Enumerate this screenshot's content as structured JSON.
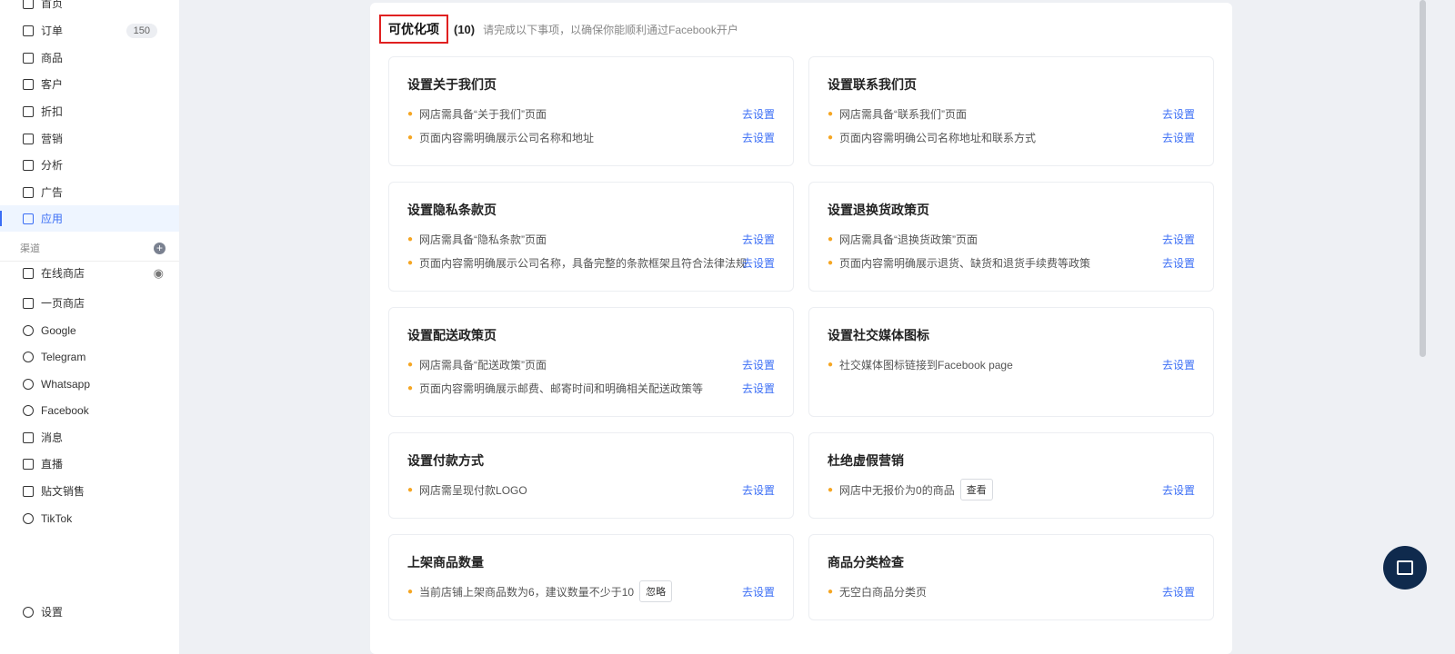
{
  "sidebar": {
    "items": [
      {
        "label": "首页",
        "icon": "home-icon"
      },
      {
        "label": "订单",
        "icon": "order-icon",
        "badge": "150"
      },
      {
        "label": "商品",
        "icon": "bag-icon"
      },
      {
        "label": "客户",
        "icon": "user-icon"
      },
      {
        "label": "折扣",
        "icon": "tag-icon"
      },
      {
        "label": "营销",
        "icon": "cube-icon"
      },
      {
        "label": "分析",
        "icon": "pie-chart-icon"
      },
      {
        "label": "广告",
        "icon": "monitor-icon"
      },
      {
        "label": "应用",
        "icon": "app-icon",
        "active": true
      }
    ],
    "section_label": "渠道",
    "channels": [
      {
        "label": "在线商店",
        "icon": "store-icon"
      },
      {
        "label": "一页商店",
        "icon": "page-icon"
      },
      {
        "label": "Google",
        "icon": "google-icon"
      },
      {
        "label": "Telegram",
        "icon": "telegram-icon"
      },
      {
        "label": "Whatsapp",
        "icon": "whatsapp-icon"
      },
      {
        "label": "Facebook",
        "icon": "facebook-icon"
      },
      {
        "label": "消息",
        "icon": "message-icon"
      },
      {
        "label": "直播",
        "icon": "video-icon"
      },
      {
        "label": "贴文销售",
        "icon": "post-icon"
      },
      {
        "label": "TikTok",
        "icon": "tiktok-icon"
      }
    ],
    "settings": "设置"
  },
  "header": {
    "title": "可优化项",
    "count": "(10)",
    "subtitle": "请完成以下事项，以确保你能顺利通过Facebook开户"
  },
  "cards": [
    {
      "title": "设置关于我们页",
      "items": [
        {
          "text": "网店需具备“关于我们”页面",
          "action": "去设置"
        },
        {
          "text": "页面内容需明确展示公司名称和地址",
          "action": "去设置"
        }
      ]
    },
    {
      "title": "设置联系我们页",
      "items": [
        {
          "text": "网店需具备“联系我们”页面",
          "action": "去设置"
        },
        {
          "text": "页面内容需明确公司名称地址和联系方式",
          "action": "去设置"
        }
      ]
    },
    {
      "title": "设置隐私条款页",
      "items": [
        {
          "text": "网店需具备“隐私条款”页面",
          "action": "去设置"
        },
        {
          "text": "页面内容需明确展示公司名称，具备完整的条款框架且符合法律法规",
          "action": "去设置"
        }
      ]
    },
    {
      "title": "设置退换货政策页",
      "items": [
        {
          "text": "网店需具备“退换货政策”页面",
          "action": "去设置"
        },
        {
          "text": "页面内容需明确展示退货、缺货和退货手续费等政策",
          "action": "去设置"
        }
      ]
    },
    {
      "title": "设置配送政策页",
      "items": [
        {
          "text": "网店需具备“配送政策”页面",
          "action": "去设置"
        },
        {
          "text": "页面内容需明确展示邮费、邮寄时间和明确相关配送政策等",
          "action": "去设置"
        }
      ]
    },
    {
      "title": "设置社交媒体图标",
      "items": [
        {
          "text": "社交媒体图标链接到Facebook page",
          "action": "去设置"
        }
      ]
    },
    {
      "title": "设置付款方式",
      "items": [
        {
          "text": "网店需呈现付款LOGO",
          "action": "去设置"
        }
      ]
    },
    {
      "title": "杜绝虚假营销",
      "items": [
        {
          "text": "网店中无报价为0的商品",
          "button": "查看",
          "action": "去设置"
        }
      ]
    },
    {
      "title": "上架商品数量",
      "items": [
        {
          "text": "当前店铺上架商品数为6，建议数量不少于10",
          "button": "忽略",
          "action": "去设置"
        }
      ]
    },
    {
      "title": "商品分类检查",
      "items": [
        {
          "text": "无空白商品分类页",
          "action": "去设置"
        }
      ]
    }
  ],
  "colors": {
    "accent": "#3b6ef5",
    "bullet": "#f5a623",
    "highlight": "#e02020",
    "chat": "#0f2a4d"
  }
}
